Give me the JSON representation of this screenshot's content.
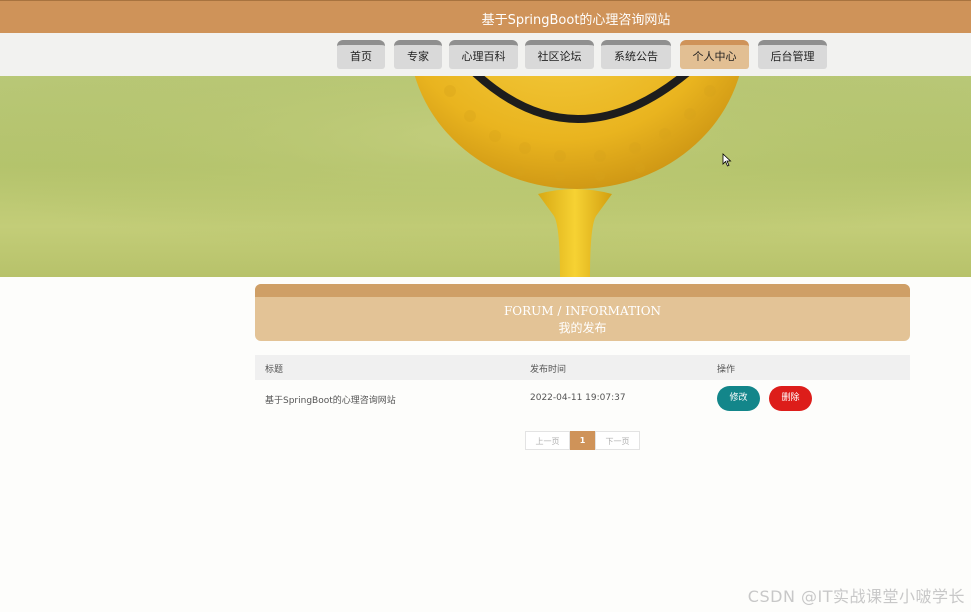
{
  "header": {
    "title": "基于SpringBoot的心理咨询网站"
  },
  "nav": {
    "items": [
      {
        "label": "首页"
      },
      {
        "label": "专家"
      },
      {
        "label": "心理百科"
      },
      {
        "label": "社区论坛"
      },
      {
        "label": "系统公告"
      },
      {
        "label": "个人中心"
      },
      {
        "label": "后台管理"
      }
    ],
    "active": "个人中心"
  },
  "panel": {
    "title_en": "FORUM / INFORMATION",
    "title_cn": "我的发布"
  },
  "table": {
    "headers": [
      "标题",
      "发布时间",
      "操作"
    ],
    "rows": [
      {
        "title": "基于SpringBoot的心理咨询网站",
        "time": "2022-04-11 19:07:37",
        "edit": "修改",
        "delete": "删除"
      }
    ]
  },
  "pagination": {
    "prev": "上一页",
    "current": "1",
    "next": "下一页"
  },
  "watermark": "CSDN @IT实战课堂小啵学长",
  "colors": {
    "brand": "#cf9359",
    "active_tab": "#e2bf93",
    "edit_button": "#13868a",
    "delete_button": "#dd1d1a"
  }
}
